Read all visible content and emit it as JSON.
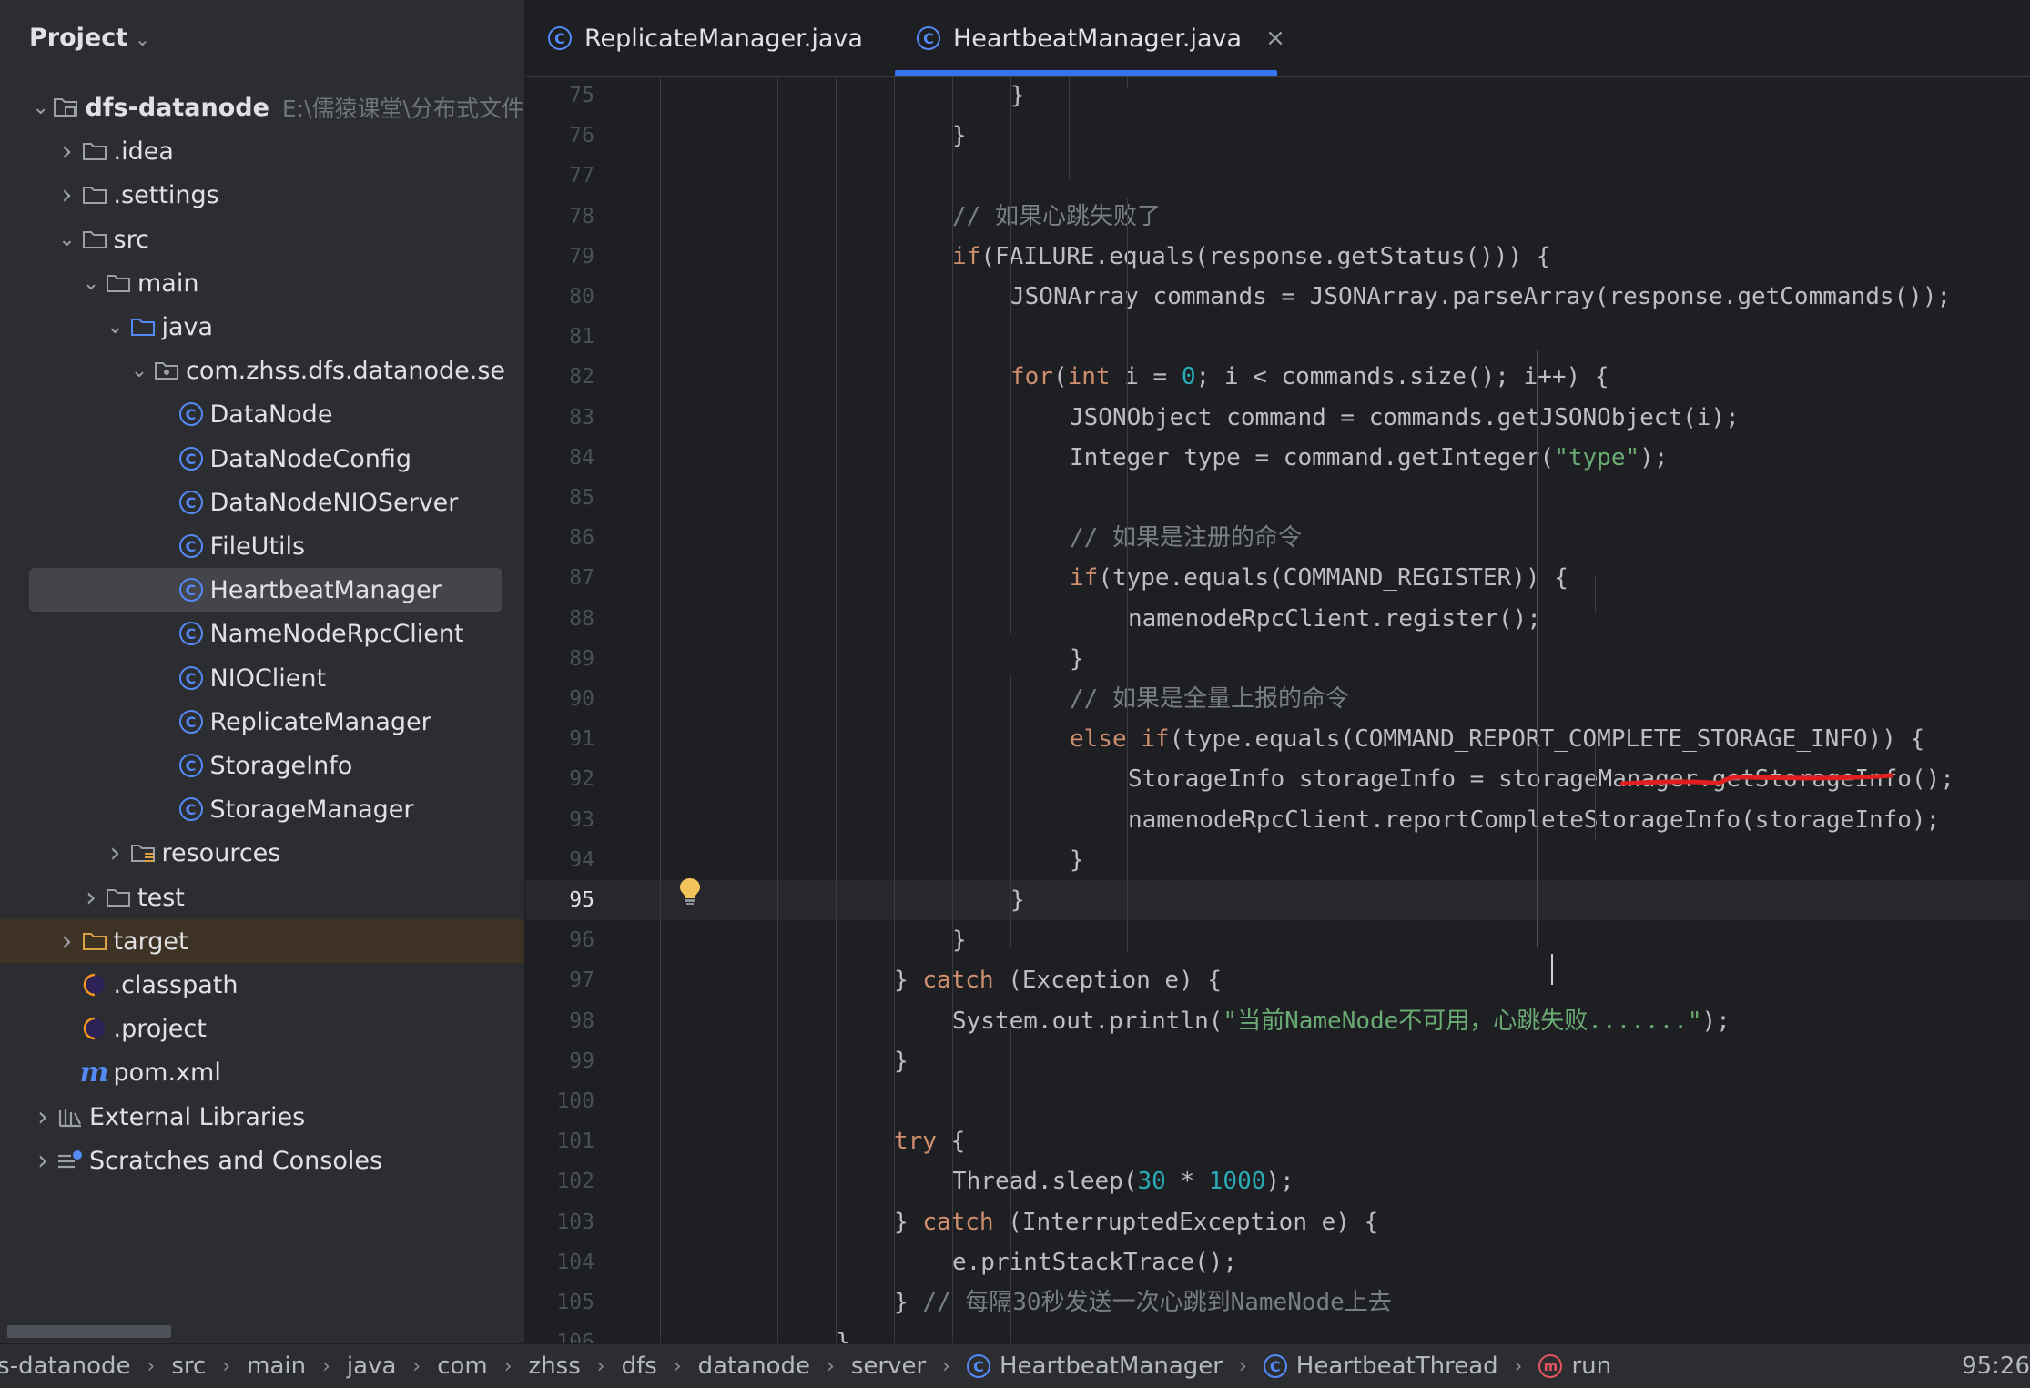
{
  "sidebar": {
    "title": "Project",
    "tree": [
      {
        "label": "dfs-datanode",
        "hint": "E:\\儒猿课堂\\分布式文件",
        "kind": "module",
        "depth": 0,
        "arrow": "down"
      },
      {
        "label": ".idea",
        "kind": "folder",
        "depth": 1,
        "arrow": "right"
      },
      {
        "label": ".settings",
        "kind": "folder",
        "depth": 1,
        "arrow": "right"
      },
      {
        "label": "src",
        "kind": "folder",
        "depth": 1,
        "arrow": "down"
      },
      {
        "label": "main",
        "kind": "folder",
        "depth": 2,
        "arrow": "down"
      },
      {
        "label": "java",
        "kind": "source-folder",
        "depth": 3,
        "arrow": "down"
      },
      {
        "label": "com.zhss.dfs.datanode.se",
        "kind": "package",
        "depth": 4,
        "arrow": "down"
      },
      {
        "label": "DataNode",
        "kind": "class",
        "depth": 5
      },
      {
        "label": "DataNodeConfig",
        "kind": "class",
        "depth": 5
      },
      {
        "label": "DataNodeNIOServer",
        "kind": "class",
        "depth": 5
      },
      {
        "label": "FileUtils",
        "kind": "class",
        "depth": 5
      },
      {
        "label": "HeartbeatManager",
        "kind": "class",
        "depth": 5,
        "selected": true
      },
      {
        "label": "NameNodeRpcClient",
        "kind": "class",
        "depth": 5
      },
      {
        "label": "NIOClient",
        "kind": "class",
        "depth": 5
      },
      {
        "label": "ReplicateManager",
        "kind": "class",
        "depth": 5
      },
      {
        "label": "StorageInfo",
        "kind": "class",
        "depth": 5
      },
      {
        "label": "StorageManager",
        "kind": "class",
        "depth": 5
      },
      {
        "label": "resources",
        "kind": "resources-folder",
        "depth": 3,
        "arrow": "right"
      },
      {
        "label": "test",
        "kind": "folder",
        "depth": 2,
        "arrow": "right"
      },
      {
        "label": "target",
        "kind": "excluded-folder",
        "depth": 1,
        "arrow": "right",
        "highlight": true
      },
      {
        "label": ".classpath",
        "kind": "eclipse-file",
        "depth": 1
      },
      {
        "label": ".project",
        "kind": "eclipse-file",
        "depth": 1
      },
      {
        "label": "pom.xml",
        "kind": "maven-file",
        "depth": 1
      },
      {
        "label": "External Libraries",
        "kind": "libraries",
        "depth": 0,
        "arrow": "right"
      },
      {
        "label": "Scratches and Consoles",
        "kind": "scratches",
        "depth": 0,
        "arrow": "right"
      }
    ]
  },
  "tabs": [
    {
      "label": "ReplicateManager.java",
      "active": false
    },
    {
      "label": "HeartbeatManager.java",
      "active": true,
      "close": "×"
    }
  ],
  "editor": {
    "current_line": 95,
    "lines": [
      {
        "n": 75,
        "indent": 8,
        "t": [
          [
            "p",
            "}"
          ]
        ]
      },
      {
        "n": 76,
        "indent": 6,
        "t": [
          [
            "p",
            "}"
          ]
        ]
      },
      {
        "n": 77,
        "indent": 0,
        "t": []
      },
      {
        "n": 78,
        "indent": 6,
        "t": [
          [
            "cm",
            "// 如果心跳失败了"
          ]
        ]
      },
      {
        "n": 79,
        "indent": 6,
        "t": [
          [
            "kw",
            "if"
          ],
          [
            "p",
            "(FAILURE.equals(response.getStatus())) {"
          ]
        ]
      },
      {
        "n": 80,
        "indent": 8,
        "t": [
          [
            "p",
            "JSONArray commands = JSONArray.parseArray(response.getCommands());"
          ]
        ]
      },
      {
        "n": 81,
        "indent": 0,
        "t": []
      },
      {
        "n": 82,
        "indent": 8,
        "t": [
          [
            "kw",
            "for"
          ],
          [
            "p",
            "("
          ],
          [
            "kw",
            "int"
          ],
          [
            "p",
            " i = "
          ],
          [
            "nm",
            "0"
          ],
          [
            "p",
            "; i < commands.size(); i++) {"
          ]
        ]
      },
      {
        "n": 83,
        "indent": 10,
        "t": [
          [
            "p",
            "JSONObject command = commands.getJSONObject(i);"
          ]
        ]
      },
      {
        "n": 84,
        "indent": 10,
        "t": [
          [
            "p",
            "Integer type = command.getInteger("
          ],
          [
            "st",
            "\"type\""
          ],
          [
            "p",
            ");"
          ]
        ]
      },
      {
        "n": 85,
        "indent": 0,
        "t": []
      },
      {
        "n": 86,
        "indent": 10,
        "t": [
          [
            "cm",
            "// 如果是注册的命令"
          ]
        ]
      },
      {
        "n": 87,
        "indent": 10,
        "t": [
          [
            "kw",
            "if"
          ],
          [
            "p",
            "(type.equals(COMMAND_REGISTER)) {"
          ]
        ]
      },
      {
        "n": 88,
        "indent": 12,
        "t": [
          [
            "p",
            "namenodeRpcClient.register();"
          ]
        ]
      },
      {
        "n": 89,
        "indent": 10,
        "t": [
          [
            "p",
            "}"
          ]
        ]
      },
      {
        "n": 90,
        "indent": 10,
        "t": [
          [
            "cm",
            "// 如果是全量上报的命令"
          ]
        ]
      },
      {
        "n": 91,
        "indent": 10,
        "t": [
          [
            "kw",
            "else if"
          ],
          [
            "p",
            "(type.equals(COMMAND_REPORT_COMPLETE_STORAGE_INFO)) {"
          ]
        ]
      },
      {
        "n": 92,
        "indent": 12,
        "t": [
          [
            "p",
            "StorageInfo storageInfo = storageManager.getStorageInfo();"
          ]
        ]
      },
      {
        "n": 93,
        "indent": 12,
        "t": [
          [
            "p",
            "namenodeRpcClient.reportCompleteStorageInfo(storageInfo);"
          ]
        ]
      },
      {
        "n": 94,
        "indent": 10,
        "t": [
          [
            "p",
            "}"
          ]
        ]
      },
      {
        "n": 95,
        "indent": 8,
        "t": [
          [
            "p",
            "}"
          ]
        ]
      },
      {
        "n": 96,
        "indent": 6,
        "t": [
          [
            "p",
            "}"
          ]
        ]
      },
      {
        "n": 97,
        "indent": 4,
        "t": [
          [
            "p",
            "} "
          ],
          [
            "kw",
            "catch"
          ],
          [
            "p",
            " (Exception e) {"
          ]
        ]
      },
      {
        "n": 98,
        "indent": 6,
        "t": [
          [
            "p",
            "System.out.println("
          ],
          [
            "st",
            "\"当前NameNode不可用，心跳失败.......\""
          ],
          [
            "p",
            ");"
          ]
        ]
      },
      {
        "n": 99,
        "indent": 4,
        "t": [
          [
            "p",
            "}"
          ]
        ]
      },
      {
        "n": 100,
        "indent": 0,
        "t": []
      },
      {
        "n": 101,
        "indent": 4,
        "t": [
          [
            "kw",
            "try"
          ],
          [
            "p",
            " {"
          ]
        ]
      },
      {
        "n": 102,
        "indent": 6,
        "t": [
          [
            "p",
            "Thread.sleep("
          ],
          [
            "nm",
            "30"
          ],
          [
            "p",
            " * "
          ],
          [
            "nm",
            "1000"
          ],
          [
            "p",
            ");"
          ]
        ]
      },
      {
        "n": 103,
        "indent": 4,
        "t": [
          [
            "p",
            "} "
          ],
          [
            "kw",
            "catch"
          ],
          [
            "p",
            " (InterruptedException e) {"
          ]
        ]
      },
      {
        "n": 104,
        "indent": 6,
        "t": [
          [
            "p",
            "e.printStackTrace();"
          ]
        ]
      },
      {
        "n": 105,
        "indent": 4,
        "t": [
          [
            "p",
            "} "
          ],
          [
            "cm",
            "// 每隔30秒发送一次心跳到NameNode上去"
          ]
        ]
      },
      {
        "n": 106,
        "indent": 2,
        "t": [
          [
            "p",
            "}"
          ]
        ]
      }
    ]
  },
  "statusbar": {
    "crumbs": [
      {
        "label": "fs-datanode"
      },
      {
        "label": "src"
      },
      {
        "label": "main"
      },
      {
        "label": "java"
      },
      {
        "label": "com"
      },
      {
        "label": "zhss"
      },
      {
        "label": "dfs"
      },
      {
        "label": "datanode"
      },
      {
        "label": "server"
      },
      {
        "label": "HeartbeatManager",
        "icon": "class"
      },
      {
        "label": "HeartbeatThread",
        "icon": "class"
      },
      {
        "label": "run",
        "icon": "method"
      }
    ],
    "cursor_position": "95:26"
  },
  "colors": {
    "accent": "#3574f0",
    "keyword": "#cf8e6d",
    "comment": "#7a7e85",
    "string": "#6aab73",
    "number": "#2aacb8",
    "annotation_underline": "#e02020"
  }
}
